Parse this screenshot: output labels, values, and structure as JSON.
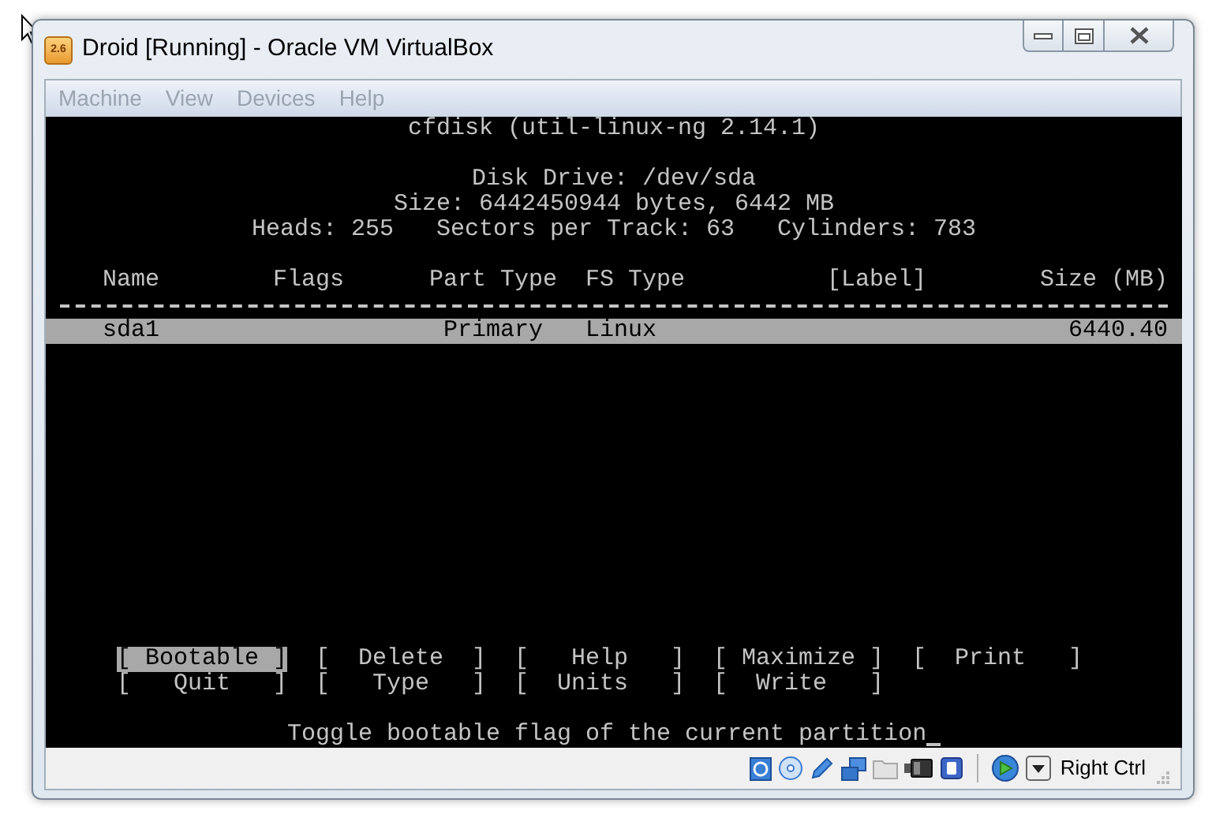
{
  "window": {
    "title": "Droid [Running] - Oracle VM VirtualBox",
    "icon_text": "2.6"
  },
  "menu": [
    {
      "label": "Machine",
      "disabled": true
    },
    {
      "label": "View",
      "disabled": true
    },
    {
      "label": "Devices",
      "disabled": true
    },
    {
      "label": "Help",
      "disabled": true
    }
  ],
  "console": {
    "title": "cfdisk (util-linux-ng 2.14.1)",
    "disk_info": [
      "Disk Drive: /dev/sda",
      "Size: 6442450944 bytes, 6442 MB",
      "Heads: 255   Sectors per Track: 63   Cylinders: 783"
    ],
    "table": {
      "columns": [
        "Name",
        "Flags",
        "Part Type",
        "FS Type",
        "[Label]",
        "Size (MB)"
      ],
      "rows": [
        {
          "name": "sda1",
          "part_type": "Primary",
          "fs_type": "Linux",
          "size": "6440.40",
          "selected": true
        }
      ]
    },
    "commands": [
      [
        {
          "label": "[ Bootable ]",
          "selected": true
        },
        {
          "label": "[  Delete  ]",
          "selected": false
        },
        {
          "label": "[   Help   ]",
          "selected": false
        },
        {
          "label": "[ Maximize ]",
          "selected": false
        },
        {
          "label": "[  Print   ]",
          "selected": false
        }
      ],
      [
        {
          "label": "[   Quit   ]",
          "selected": false
        },
        {
          "label": "[   Type   ]",
          "selected": false
        },
        {
          "label": "[  Units   ]",
          "selected": false
        },
        {
          "label": "[  Write   ]",
          "selected": false
        }
      ]
    ],
    "message": "Toggle bootable flag of the current partition"
  },
  "status_bar": {
    "host_key": "Right Ctrl"
  }
}
